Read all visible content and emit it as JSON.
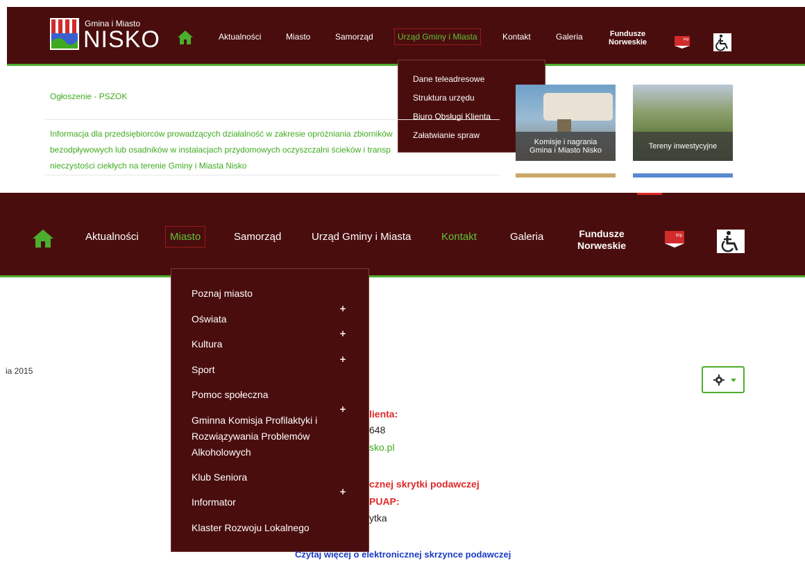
{
  "top_header": {
    "logo_small": "Gmina i Miasto",
    "logo_big": "NISKO",
    "nav": [
      "Aktualności",
      "Miasto",
      "Samorząd",
      "Urząd Gminy i Miasta",
      "Kontakt",
      "Galeria"
    ],
    "funds_line1": "Fundusze",
    "funds_line2": "Norweskie",
    "bip": "bip"
  },
  "top_dropdown": {
    "items": [
      "Dane teleadresowe",
      "Struktura urzędu",
      "Biuro Obsługi Klienta",
      "Załatwianie spraw"
    ]
  },
  "content_top": {
    "announcement": "Ogłoszenie - PSZOK",
    "info_line1": "Informacja dla przedsiębiorców prowadzących działalność w zakresie opróżniania zbiorników",
    "info_line2": "bezodpływowych lub osadników w instalacjach przydomowych oczyszczalni ścieków i transp",
    "info_line3": "nieczystości ciekłych na terenie Gminy i Miasta Nisko",
    "tile1_line1": "Komisje i nagrania",
    "tile1_line2": "Gmina i Miasto Nisko",
    "tile2": "Tereny inwestycyjne"
  },
  "bottom_header": {
    "nav": [
      "Aktualności",
      "Miasto",
      "Samorząd",
      "Urząd Gminy i Miasta",
      "Kontakt",
      "Galeria"
    ],
    "funds_line1": "Fundusze",
    "funds_line2": "Norweskie",
    "bip": "bip"
  },
  "bottom_dropdown": {
    "items": [
      "Poznaj miasto",
      "Oświata",
      "Kultura",
      "Sport",
      "Pomoc społeczna",
      "Gminna Komisja Profilaktyki i",
      "Rozwiązywania Problemów",
      "Alkoholowych",
      "Klub Seniora",
      "Informator",
      "Klaster Rozwoju Lokalnego"
    ],
    "plus": "+"
  },
  "lower": {
    "date": "ia 2015",
    "client_heading": "lienta:",
    "phone": "648",
    "email": "sko.pl",
    "skrytka_heading": "cznej skrytki podawczej",
    "puap": "PUAP:",
    "skrytka": "ytka",
    "read_more": "Czytaj więcej o elektronicznej skrzynce podawczej"
  },
  "colors": {
    "maroon": "#4a0d0d",
    "green": "#4cae2e",
    "red": "#e02828",
    "link_blue": "#1a3cc4"
  }
}
